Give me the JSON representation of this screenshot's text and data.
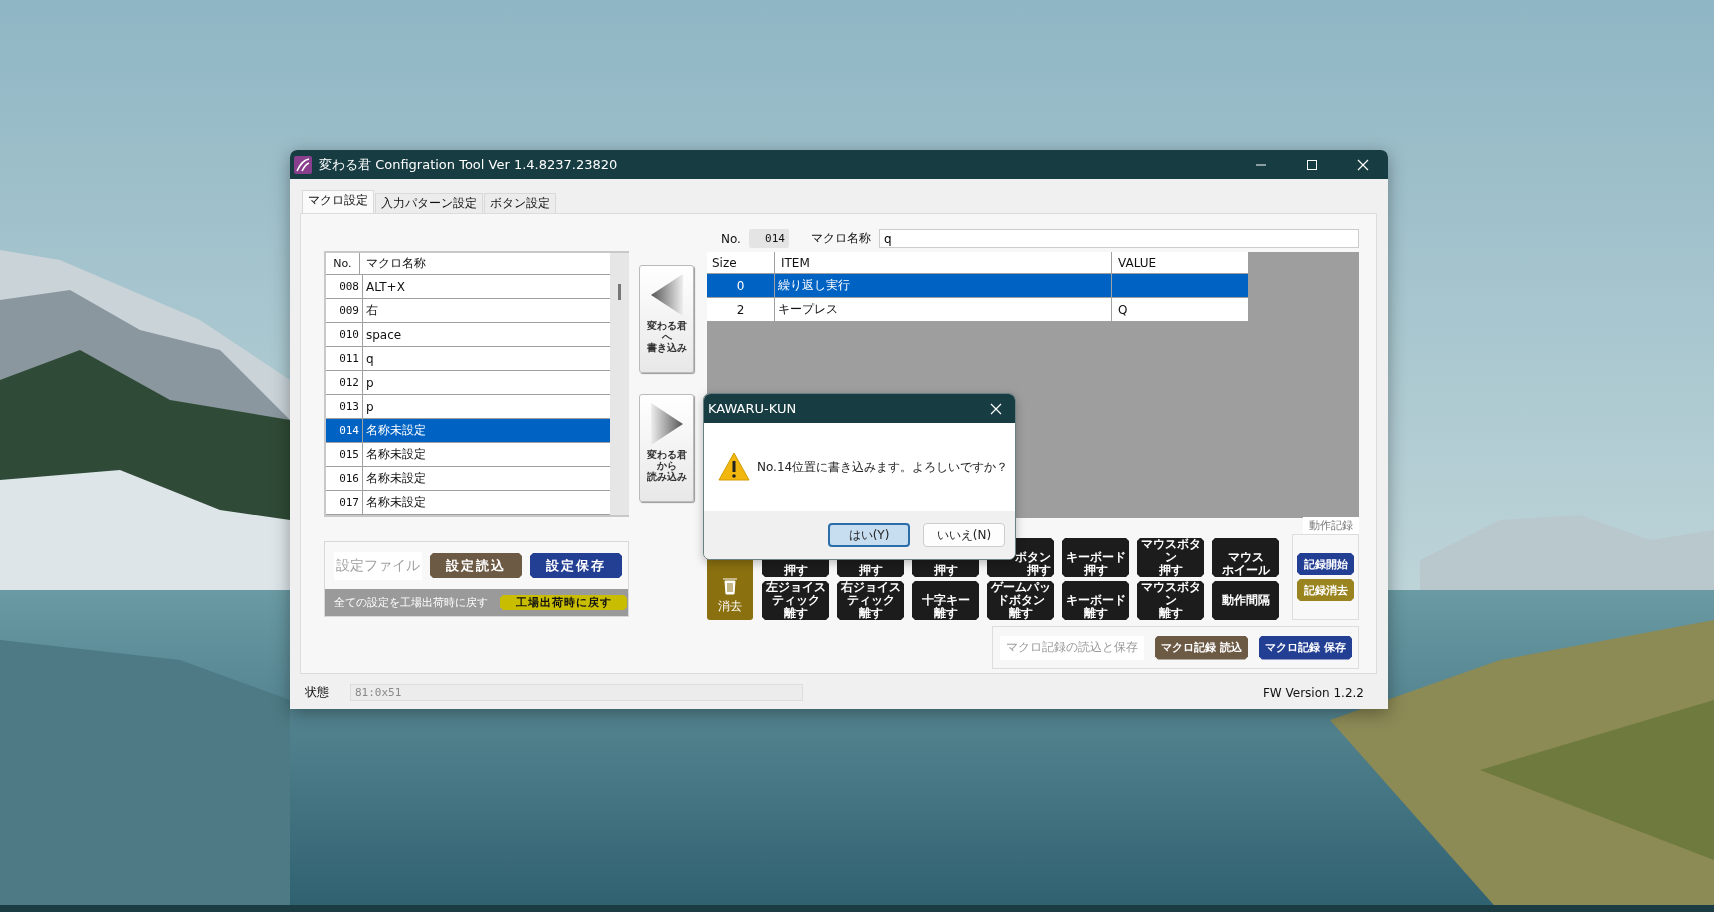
{
  "window": {
    "title": "変わる君 Configration Tool Ver 1.4.8237.23820"
  },
  "tabs": [
    {
      "label": "マクロ設定",
      "selected": true
    },
    {
      "label": "入力パターン設定",
      "selected": false
    },
    {
      "label": "ボタン設定",
      "selected": false
    }
  ],
  "macro_list": {
    "columns": [
      "No.",
      "マクロ名称"
    ],
    "rows": [
      {
        "no": "008",
        "name": "ALT+X",
        "selected": false
      },
      {
        "no": "009",
        "name": "右",
        "selected": false
      },
      {
        "no": "010",
        "name": "space",
        "selected": false
      },
      {
        "no": "011",
        "name": "q",
        "selected": false
      },
      {
        "no": "012",
        "name": "p",
        "selected": false
      },
      {
        "no": "013",
        "name": "p",
        "selected": false
      },
      {
        "no": "014",
        "name": "名称未設定",
        "selected": true
      },
      {
        "no": "015",
        "name": "名称未設定",
        "selected": false
      },
      {
        "no": "016",
        "name": "名称未設定",
        "selected": false
      },
      {
        "no": "017",
        "name": "名称未設定",
        "selected": false
      }
    ]
  },
  "transfer_buttons": [
    {
      "kind": "left",
      "lines": [
        "変わる君",
        "へ",
        "書き込み"
      ]
    },
    {
      "kind": "right",
      "lines": [
        "変わる君",
        "から",
        "読み込み"
      ]
    }
  ],
  "settings_file": {
    "label": "設定ファイル",
    "buttons": [
      {
        "label": "設定読込",
        "kind": "load"
      },
      {
        "label": "設定保存",
        "kind": "save"
      }
    ]
  },
  "factory_reset": {
    "text": "全ての設定を工場出荷時に戻す",
    "button": "工場出荷時に戻す"
  },
  "macro_header": {
    "no_label": "No.",
    "no": "014",
    "name_label": "マクロ名称",
    "name": "q"
  },
  "steps": {
    "columns": [
      "Size",
      "ITEM",
      "VALUE"
    ],
    "rows": [
      {
        "size": "0",
        "item": "繰り返し実行",
        "selected": true
      },
      {
        "size": "2",
        "item": "キープレス",
        "value": "Q",
        "selected": false
      }
    ]
  },
  "action_palette": {
    "clear_button": "消去",
    "buttons": [
      {
        "lines": [
          "押す"
        ],
        "cut": false
      },
      {
        "lines": [
          "押す"
        ],
        "cut": false
      },
      {
        "lines": [
          "押す"
        ],
        "cut": false
      },
      {
        "lines": [
          "ボタン",
          "押す"
        ],
        "cut": true
      },
      {
        "lines": [
          "キーボード",
          "押す"
        ],
        "cut": false
      },
      {
        "lines": [
          "マウスボタン",
          "押す"
        ],
        "cut": false
      },
      {
        "lines": [
          "マウス",
          "ホイール"
        ],
        "cut": false
      },
      {
        "lines": [
          "左ジョイスティック",
          "離す"
        ],
        "cut": false
      },
      {
        "lines": [
          "右ジョイスティック",
          "離す"
        ],
        "cut": false
      },
      {
        "lines": [
          "十字キー",
          "離す"
        ],
        "cut": false
      },
      {
        "lines": [
          "ゲームパッドボタン",
          "離す"
        ],
        "cut": false
      },
      {
        "lines": [
          "キーボード",
          "離す"
        ],
        "cut": false
      },
      {
        "lines": [
          "マウスボタン",
          "離す"
        ],
        "cut": false
      },
      {
        "lines": [
          "動作間隔"
        ],
        "cut": false
      }
    ]
  },
  "action_record": {
    "label": "動作記録",
    "buttons": [
      {
        "label": "記録開始",
        "kind": "start"
      },
      {
        "label": "記録消去",
        "kind": "clear"
      }
    ]
  },
  "macro_record": {
    "label": "マクロ記録の読込と保存",
    "buttons": [
      {
        "label": "マクロ記録 読込",
        "kind": "load"
      },
      {
        "label": "マクロ記録 保存",
        "kind": "save"
      }
    ]
  },
  "status_bar": {
    "label": "状態",
    "value": "81:0x51",
    "fw_version": "FW Version 1.2.2"
  },
  "dialog": {
    "title": "KAWARU-KUN",
    "message": "No.14位置に書き込みます。よろしいですか？",
    "buttons": [
      {
        "label": "はい(Y)",
        "selected": true
      },
      {
        "label": "いいえ(N)",
        "selected": false
      }
    ]
  }
}
